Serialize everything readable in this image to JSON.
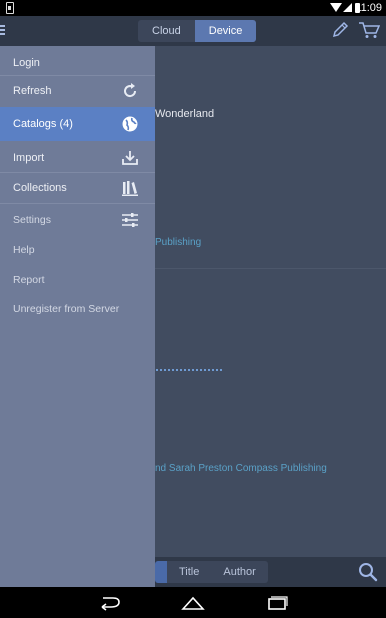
{
  "status_bar": {
    "time": "11:09",
    "icons": [
      "sim-icon",
      "wifi-icon",
      "signal-icon",
      "battery-icon"
    ]
  },
  "action_bar": {
    "tabs": [
      {
        "label": "Cloud",
        "active": false
      },
      {
        "label": "Device",
        "active": true
      }
    ],
    "icons": [
      "menu-icon",
      "pencil-icon",
      "cart-icon"
    ]
  },
  "drawer": {
    "items": [
      {
        "label": "Login",
        "icon": null,
        "selected": false
      },
      {
        "label": "Refresh",
        "icon": "refresh-icon",
        "selected": false
      },
      {
        "label": "Catalogs (4)",
        "icon": "globe-icon",
        "selected": true
      },
      {
        "label": "Import",
        "icon": "import-icon",
        "selected": false
      },
      {
        "label": "Collections",
        "icon": "books-icon",
        "selected": false
      },
      {
        "label": "Settings",
        "icon": "sliders-icon",
        "selected": false
      },
      {
        "label": "Help",
        "icon": null,
        "selected": false
      },
      {
        "label": "Report",
        "icon": null,
        "selected": false
      },
      {
        "label": "Unregister from Server",
        "icon": null,
        "selected": false
      }
    ]
  },
  "content": {
    "visible_title_fragment": "Wonderland",
    "visible_publisher_fragment_1": "Publishing",
    "visible_publisher_fragment_2": "nd Sarah Preston  Compass Publishing"
  },
  "bottom_bar": {
    "sort_tabs": [
      {
        "label": "",
        "active": true
      },
      {
        "label": "Title",
        "active": false
      },
      {
        "label": "Author",
        "active": false
      }
    ],
    "icons": [
      "search-icon"
    ]
  },
  "nav_bar": {
    "icons": [
      "back-icon",
      "home-icon",
      "recents-icon"
    ]
  },
  "colors": {
    "accent": "#5b80c4",
    "drawer_bg": "#6f7b98",
    "content_bg": "#414c60",
    "link": "#5aa1c7"
  }
}
